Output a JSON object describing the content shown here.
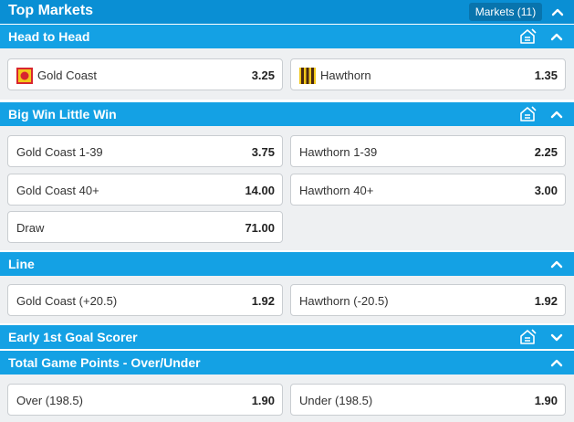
{
  "header": {
    "title": "Top Markets",
    "markets_label": "Markets (11)",
    "chevron_icon": "chevron-up-icon"
  },
  "colors": {
    "header_bg": "#0a8fd4",
    "section_bg": "#14a1e4",
    "body_bg": "#eef0f2"
  },
  "sections": [
    {
      "title": "Head to Head",
      "has_bet_icon": true,
      "expanded": true,
      "options": [
        {
          "label": "Gold Coast",
          "price": "3.25",
          "flag": "gold-coast-flag-icon"
        },
        {
          "label": "Hawthorn",
          "price": "1.35",
          "flag": "hawthorn-flag-icon"
        }
      ]
    },
    {
      "title": "Big Win Little Win",
      "has_bet_icon": true,
      "expanded": true,
      "options": [
        {
          "label": "Gold Coast 1-39",
          "price": "3.75"
        },
        {
          "label": "Hawthorn 1-39",
          "price": "2.25"
        },
        {
          "label": "Gold Coast 40+",
          "price": "14.00"
        },
        {
          "label": "Hawthorn 40+",
          "price": "3.00"
        },
        {
          "label": "Draw",
          "price": "71.00"
        }
      ]
    },
    {
      "title": "Line",
      "has_bet_icon": false,
      "expanded": true,
      "options": [
        {
          "label": "Gold Coast (+20.5)",
          "price": "1.92"
        },
        {
          "label": "Hawthorn (-20.5)",
          "price": "1.92"
        }
      ]
    },
    {
      "title": "Early 1st Goal Scorer",
      "has_bet_icon": true,
      "expanded": false,
      "options": []
    },
    {
      "title": "Total Game Points - Over/Under",
      "has_bet_icon": false,
      "expanded": true,
      "options": [
        {
          "label": "Over (198.5)",
          "price": "1.90"
        },
        {
          "label": "Under (198.5)",
          "price": "1.90"
        }
      ]
    }
  ]
}
